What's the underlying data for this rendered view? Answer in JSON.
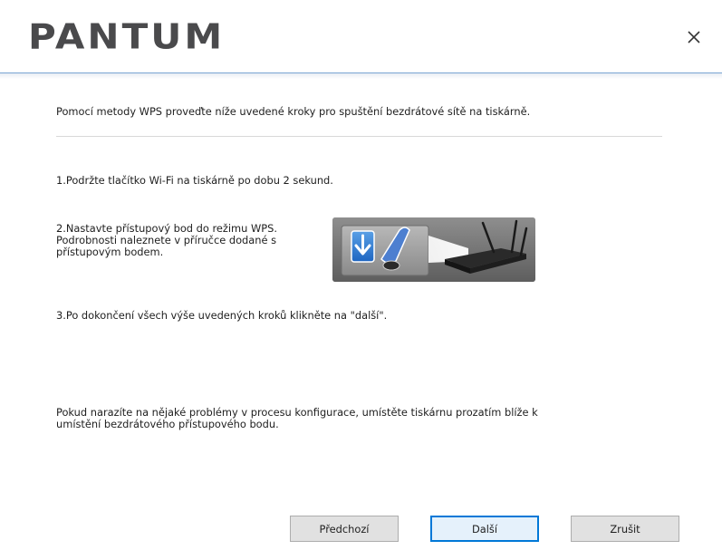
{
  "header": {
    "logo_text": "PANTUM",
    "close_label": "×"
  },
  "content": {
    "intro": "Pomocí metody WPS proveďte níže uvedené kroky pro spuštění bezdrátové sítě na tiskárně.",
    "step1": "1.Podržte tlačítko Wi-Fi na tiskárně po dobu 2 sekund.",
    "step2": "2.Nastavte přístupový bod do režimu WPS.\nPodrobnosti naleznete v příručce dodané s\npřístupovým bodem.",
    "step3": "3.Po dokončení všech výše uvedených kroků klikněte na \"další\".",
    "note": "Pokud narazíte na nějaké problémy v procesu konfigurace, umístěte tiskárnu prozatím blíže k\numístění bezdrátového přístupového bodu."
  },
  "buttons": {
    "previous": "Předchozí",
    "next": "Další",
    "cancel": "Zrušit"
  },
  "colors": {
    "brand_gray": "#4a4a4c",
    "accent_blue": "#0078d7",
    "header_line": "#7aa6d3"
  }
}
